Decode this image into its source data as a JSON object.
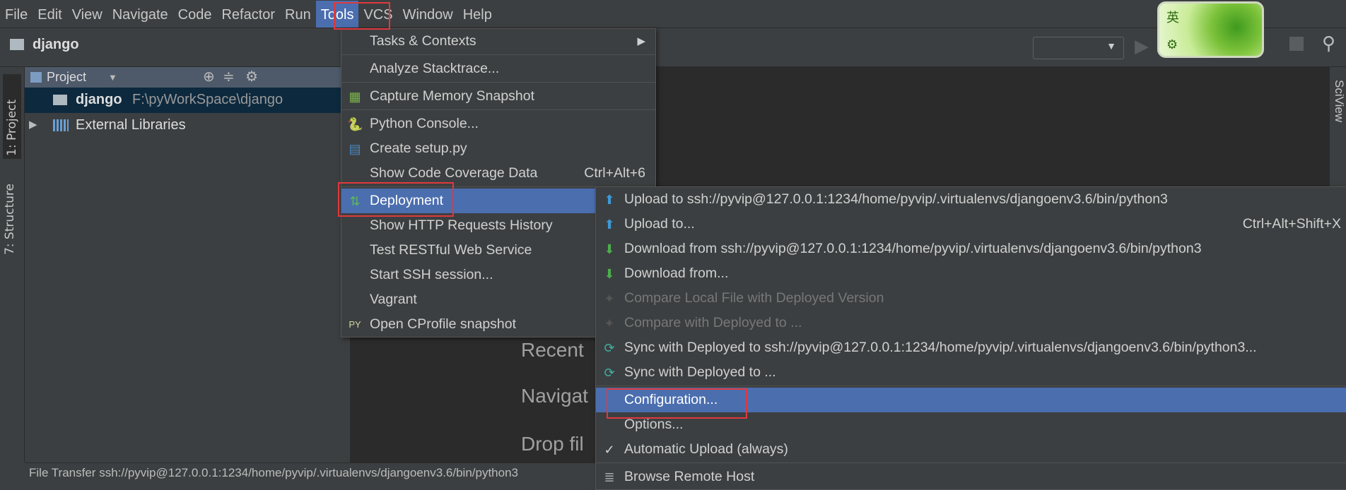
{
  "menubar": [
    "File",
    "Edit",
    "View",
    "Navigate",
    "Code",
    "Refactor",
    "Run",
    "Tools",
    "VCS",
    "Window",
    "Help"
  ],
  "active_menu": "Tools",
  "breadcrumb": "django",
  "left_tabs": [
    "1: Project",
    "7: Structure"
  ],
  "right_tabs": [
    "SciView"
  ],
  "project": {
    "header": "Project",
    "root_name": "django",
    "root_path": "F:\\pyWorkSpace\\django",
    "external": "External Libraries"
  },
  "tools_menu": [
    {
      "label": "Tasks & Contexts",
      "submenu": true
    },
    {
      "label": "Analyze Stacktrace..."
    },
    {
      "label": "Capture Memory Snapshot",
      "icon": "memory-icon"
    },
    {
      "label": "Python Console...",
      "icon": "python-icon"
    },
    {
      "label": "Create setup.py",
      "icon": "python-file-icon"
    },
    {
      "label": "Show Code Coverage Data",
      "shortcut": "Ctrl+Alt+6"
    },
    {
      "label": "Deployment",
      "icon": "deployment-icon",
      "selected": true
    },
    {
      "label": "Show HTTP Requests History"
    },
    {
      "label": "Test RESTful Web Service"
    },
    {
      "label": "Start SSH session..."
    },
    {
      "label": "Vagrant"
    },
    {
      "label": "Open CProfile snapshot",
      "icon": "cprofile-icon"
    }
  ],
  "deployment_menu": [
    {
      "label": "Upload to ssh://pyvip@127.0.0.1:1234/home/pyvip/.virtualenvs/djangoenv3.6/bin/python3",
      "icon": "upload-icon"
    },
    {
      "label": "Upload to...",
      "shortcut": "Ctrl+Alt+Shift+X",
      "icon": "upload-icon"
    },
    {
      "label": "Download from ssh://pyvip@127.0.0.1:1234/home/pyvip/.virtualenvs/djangoenv3.6/bin/python3",
      "icon": "download-icon"
    },
    {
      "label": "Download from...",
      "icon": "download-icon"
    },
    {
      "label": "Compare Local File with Deployed Version",
      "disabled": true,
      "icon": "compare-icon"
    },
    {
      "label": "Compare with Deployed to ...",
      "disabled": true,
      "icon": "compare-icon"
    },
    {
      "label": "Sync with Deployed to ssh://pyvip@127.0.0.1:1234/home/pyvip/.virtualenvs/djangoenv3.6/bin/python3...",
      "icon": "sync-icon"
    },
    {
      "label": "Sync with Deployed to ...",
      "icon": "sync-icon"
    },
    {
      "label": "Configuration...",
      "selected": true
    },
    {
      "label": "Options..."
    },
    {
      "label": "Automatic Upload (always)",
      "checked": true
    },
    {
      "label": "Browse Remote Host",
      "icon": "server-icon"
    }
  ],
  "editor_hints": [
    "Recent",
    "Navigat",
    "Drop fil"
  ],
  "status": "File Transfer ssh://pyvip@127.0.0.1:1234/home/pyvip/.virtualenvs/djangoenv3.6/bin/python3",
  "ime": {
    "lang": "英"
  },
  "colors": {
    "selection": "#4b6eaf",
    "highlight_box": "#e0393e",
    "background": "#3c3f41",
    "editor": "#2b2b2b"
  }
}
